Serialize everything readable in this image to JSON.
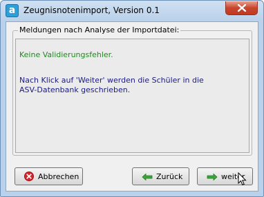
{
  "window": {
    "title": "Zeugnisnotenimport, Version 0.1",
    "app_icon_glyph": "a"
  },
  "group": {
    "legend": "Meldungen nach Analyse der Importdatei:",
    "messages": {
      "ok": "Keine Validierungsfehler.",
      "info_line1": "Nach Klick auf 'Weiter' werden die Schüler in die",
      "info_line2": "ASV-Datenbank geschrieben."
    }
  },
  "buttons": {
    "cancel": "Abbrechen",
    "back": "Zurück",
    "next": "weiter"
  },
  "icons": {
    "app": "app-logo-icon",
    "close": "close-icon",
    "cancel": "red-x-circle-icon",
    "back": "green-arrow-left-icon",
    "next": "green-arrow-right-icon",
    "cursor": "mouse-pointer-icon"
  },
  "colors": {
    "ok_text": "#1e8a1e",
    "info_text": "#1a1a80",
    "close_button": "#c9452c",
    "arrow": "#3aa63a"
  }
}
